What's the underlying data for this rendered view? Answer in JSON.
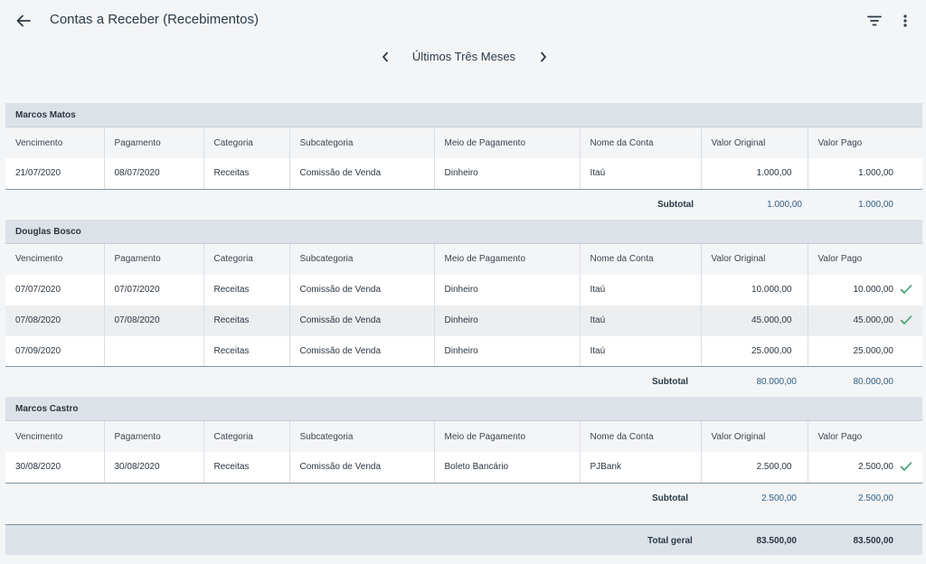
{
  "header": {
    "title": "Contas a Receber (Recebimentos)",
    "back_icon": "arrow-left-icon",
    "filter_icon": "filter-icon",
    "more_icon": "more-vertical-icon"
  },
  "period": {
    "label": "Últimos Três Meses"
  },
  "columns": [
    "Vencimento",
    "Pagamento",
    "Categoria",
    "Subcategoria",
    "Meio de Pagamento",
    "Nome da Conta",
    "Valor Original",
    "Valor Pago"
  ],
  "groups": [
    {
      "name": "Marcos Matos",
      "rows": [
        {
          "vencimento": "21/07/2020",
          "pagamento": "08/07/2020",
          "categoria": "Receitas",
          "subcategoria": "Comissão de Venda",
          "meio": "Dinheiro",
          "conta": "Itaú",
          "original": "1.000,00",
          "pago": "1.000,00",
          "confirmed": false
        }
      ],
      "subtotal_label": "Subtotal",
      "subtotal_original": "1.000,00",
      "subtotal_pago": "1.000,00"
    },
    {
      "name": "Douglas Bosco",
      "rows": [
        {
          "vencimento": "07/07/2020",
          "pagamento": "07/07/2020",
          "categoria": "Receitas",
          "subcategoria": "Comissão de Venda",
          "meio": "Dinheiro",
          "conta": "Itaú",
          "original": "10.000,00",
          "pago": "10.000,00",
          "confirmed": true
        },
        {
          "vencimento": "07/08/2020",
          "pagamento": "07/08/2020",
          "categoria": "Receitas",
          "subcategoria": "Comissão de Venda",
          "meio": "Dinheiro",
          "conta": "Itaú",
          "original": "45.000,00",
          "pago": "45.000,00",
          "confirmed": true
        },
        {
          "vencimento": "07/09/2020",
          "pagamento": "",
          "categoria": "Receitas",
          "subcategoria": "Comissão de Venda",
          "meio": "Dinheiro",
          "conta": "Itaú",
          "original": "25.000,00",
          "pago": "25.000,00",
          "confirmed": false
        }
      ],
      "subtotal_label": "Subtotal",
      "subtotal_original": "80.000,00",
      "subtotal_pago": "80.000,00"
    },
    {
      "name": "Marcos Castro",
      "rows": [
        {
          "vencimento": "30/08/2020",
          "pagamento": "30/08/2020",
          "categoria": "Receitas",
          "subcategoria": "Comissão de Venda",
          "meio": "Boleto Bancário",
          "conta": "PJBank",
          "original": "2.500,00",
          "pago": "2.500,00",
          "confirmed": true
        }
      ],
      "subtotal_label": "Subtotal",
      "subtotal_original": "2.500,00",
      "subtotal_pago": "2.500,00"
    }
  ],
  "total": {
    "label": "Total geral",
    "original": "83.500,00",
    "pago": "83.500,00"
  },
  "colors": {
    "check": "#3aa06a",
    "subtotal_value": "#2f5f86",
    "group_header_bg": "#dde2e8"
  }
}
